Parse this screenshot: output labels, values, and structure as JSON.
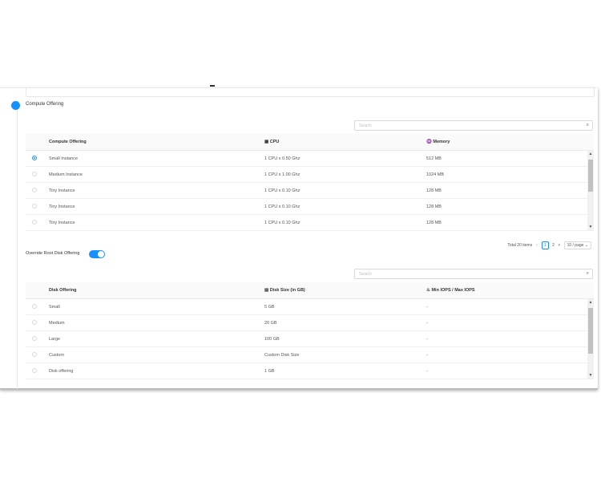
{
  "compute": {
    "step_title": "Compute Offering",
    "search_placeholder": "Search",
    "headers": {
      "name": "Compute Offering",
      "cpu": "CPU",
      "memory": "Memory"
    },
    "rows": [
      {
        "name": "Small Instance",
        "cpu": "1 CPU x 0.50 Ghz",
        "memory": "512 MB",
        "selected": true
      },
      {
        "name": "Medium Instance",
        "cpu": "1 CPU x 1.00 Ghz",
        "memory": "1024 MB",
        "selected": false
      },
      {
        "name": "Tiny Instance",
        "cpu": "1 CPU x 0.10 Ghz",
        "memory": "128 MB",
        "selected": false
      },
      {
        "name": "Tiny Instance",
        "cpu": "1 CPU x 0.10 Ghz",
        "memory": "128 MB",
        "selected": false
      },
      {
        "name": "Tiny Instance",
        "cpu": "1 CPU x 0.10 Ghz",
        "memory": "128 MB",
        "selected": false
      }
    ],
    "pagination": {
      "total": "Total 20 items",
      "prev": "<",
      "page1": "1",
      "page2": "2",
      "next": ">",
      "page_size": "10 / page ⌄"
    }
  },
  "override": {
    "label": "Override Root Disk Offering",
    "enabled": true
  },
  "disk": {
    "search_placeholder": "Search",
    "headers": {
      "name": "Disk Offering",
      "size": "Disk Size (in GB)",
      "iops": "Min IOPS / Max IOPS"
    },
    "rows": [
      {
        "name": "Small",
        "size": "5 GB",
        "iops": "-"
      },
      {
        "name": "Medium",
        "size": "20 GB",
        "iops": "-"
      },
      {
        "name": "Large",
        "size": "100 GB",
        "iops": "-"
      },
      {
        "name": "Custom",
        "size": "Custom Disk Size",
        "iops": "-"
      },
      {
        "name": "Disk offering",
        "size": "1 GB",
        "iops": "-"
      }
    ]
  },
  "colors": {
    "accent": "#1890ff",
    "border": "#e8e8e8",
    "header_bg": "#fafafa"
  },
  "icons": {
    "search": "search-icon",
    "cpu": "cpu-icon",
    "memory": "bulb-icon",
    "disk": "hdd-icon",
    "iops": "fire-icon"
  }
}
